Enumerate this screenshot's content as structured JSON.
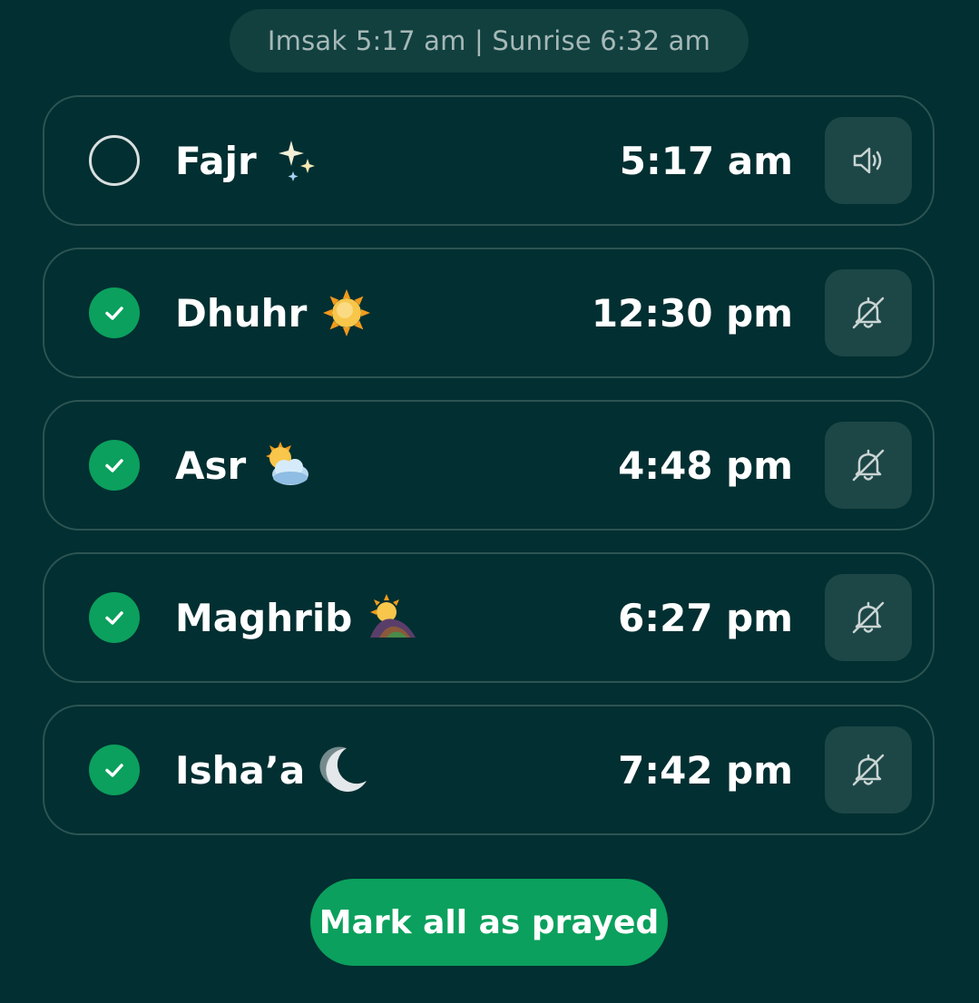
{
  "header": {
    "info_text": "Imsak 5:17 am | Sunrise 6:32 am"
  },
  "prayers": [
    {
      "name": "Fajr",
      "time": "5:17 am",
      "prayed": false,
      "emoji_icon": "sparkles-icon",
      "alert_icon": "speaker-icon"
    },
    {
      "name": "Dhuhr",
      "time": "12:30 pm",
      "prayed": true,
      "emoji_icon": "sun-icon",
      "alert_icon": "bell-off-icon"
    },
    {
      "name": "Asr",
      "time": "4:48 pm",
      "prayed": true,
      "emoji_icon": "sun-behind-cloud-icon",
      "alert_icon": "bell-off-icon"
    },
    {
      "name": "Maghrib",
      "time": "6:27 pm",
      "prayed": true,
      "emoji_icon": "sunset-icon",
      "alert_icon": "bell-off-icon"
    },
    {
      "name": "Isha’a",
      "time": "7:42 pm",
      "prayed": true,
      "emoji_icon": "crescent-moon-icon",
      "alert_icon": "bell-off-icon"
    }
  ],
  "actions": {
    "mark_all_label": "Mark all as prayed"
  },
  "colors": {
    "background": "#022f31",
    "accent_green": "#0ba05d",
    "card_border": "#2c5453",
    "button_bg": "#1d4746"
  }
}
